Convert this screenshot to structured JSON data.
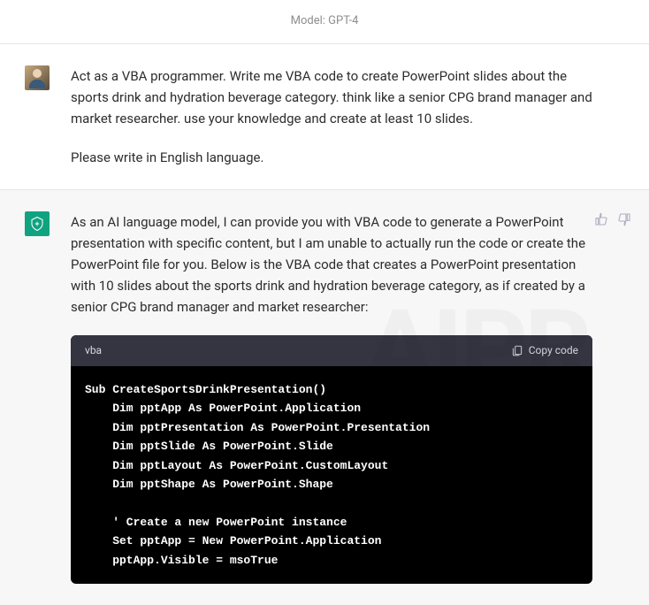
{
  "header": {
    "model_label": "Model: GPT-4"
  },
  "user_message": {
    "p1": "Act as a VBA programmer. Write me VBA code to create PowerPoint slides about the sports drink and hydration beverage category. think like a senior CPG brand manager and market researcher. use your knowledge and create at least 10 slides.",
    "p2": "Please write in English language."
  },
  "assistant_message": {
    "p1": "As an AI language model, I can provide you with VBA code to generate a PowerPoint presentation with specific content, but I am unable to actually run the code or create the PowerPoint file for you. Below is the VBA code that creates a PowerPoint presentation with 10 slides about the sports drink and hydration beverage category, as if created by a senior CPG brand manager and market researcher:"
  },
  "code": {
    "language": "vba",
    "copy_label": "Copy code",
    "content": "Sub CreateSportsDrinkPresentation()\n    Dim pptApp As PowerPoint.Application\n    Dim pptPresentation As PowerPoint.Presentation\n    Dim pptSlide As PowerPoint.Slide\n    Dim pptLayout As PowerPoint.CustomLayout\n    Dim pptShape As PowerPoint.Shape\n\n    ' Create a new PowerPoint instance\n    Set pptApp = New PowerPoint.Application\n    pptApp.Visible = msoTrue"
  },
  "watermark": "AIPR"
}
